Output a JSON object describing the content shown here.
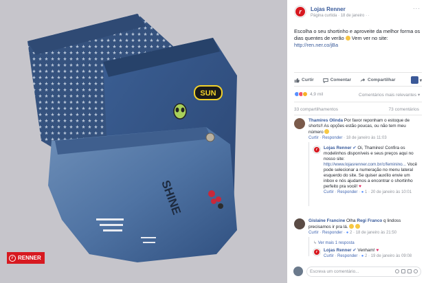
{
  "photo": {
    "watermark_text": "RENNER",
    "patch_text": "SUN",
    "paint_text": "SHINE",
    "alt": "photo"
  },
  "post": {
    "page_name": "Lojas Renner",
    "page_logo_letter": "r",
    "meta_type": "Página curtida",
    "meta_sep": " · ",
    "meta_date": "18 de janeiro",
    "meta_globe": "·",
    "more": "···",
    "caption_text": "Escolha o seu shortinho e aproveite da melhor forma os dias quentes de verão",
    "caption_cta": " Vem ver no site:",
    "caption_link": "http://ren.ner.co/jBa"
  },
  "actions": {
    "like": "Curtir",
    "comment": "Comentar",
    "share": "Compartilhar",
    "dropdown": "▾"
  },
  "reactions": {
    "count": "4,9 mil",
    "relevant": "Comentários mais relevantes ▾",
    "shares": "33 compartilhamentos",
    "comments": "73 comentários"
  },
  "comments": [
    {
      "name": "Thamires Olinda",
      "text": " Por favor reponham o estoque de shorts!! As opções estão poucas, ou não tem meu número",
      "like": "Curtir",
      "reply": "Responder",
      "date": "18 de janeiro às 11:03"
    },
    {
      "name": "Lojas Renner",
      "verified": "✔",
      "text": " Oi, Thamires! Confira os modelinhos disponíveis e seus preços aqui no nosso site: ",
      "link": "http://www.lojasrenner.com.br/c/feminino...",
      "text2": " Você pode selecionar a numeração no menu lateral esquerdo do site. Se quiser auxílio envie um inbox e nós ajudamos a encontrar o shortinho perfeito pra você!",
      "like": "Curtir",
      "reply": "Responder",
      "count": "1",
      "date": "20 de janeiro às 10:01"
    },
    {
      "name": "Gislaine Francine",
      "text": " Olha ",
      "mention": "Regi Franco",
      "text2": " q lindoss precisamos ir pra lá.",
      "like": "Curtir",
      "reply": "Responder",
      "count": "2",
      "date": "18 de janeiro às 21:50"
    },
    {
      "more_replies": "Ver mais 1 resposta"
    },
    {
      "name": "Lojas Renner",
      "verified": "✔",
      "text": " Venham!",
      "like": "Curtir",
      "reply": "Responder",
      "count": "2",
      "date": "19 de janeiro às 09:08"
    }
  ],
  "composer": {
    "placeholder": "Escreva um comentário..."
  },
  "colors": {
    "brand": "#d71920",
    "link": "#365899",
    "meta": "#90949c"
  }
}
